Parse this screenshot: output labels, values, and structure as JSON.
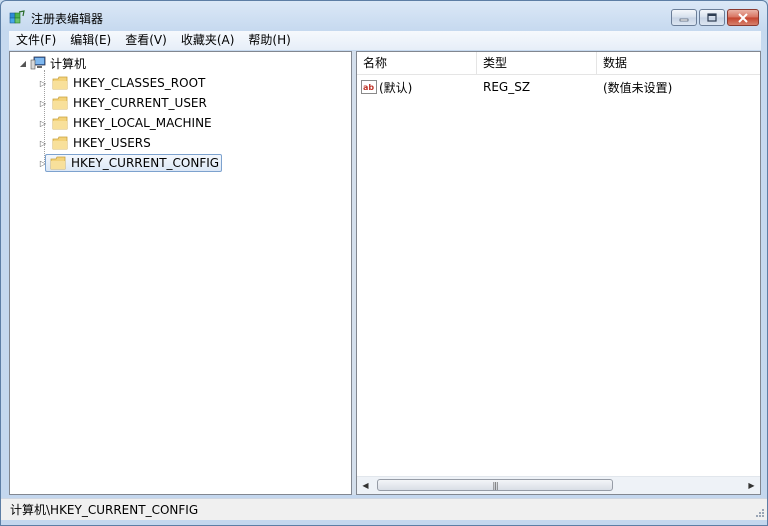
{
  "window": {
    "title": "注册表编辑器"
  },
  "menu": [
    {
      "label": "文件(F)"
    },
    {
      "label": "编辑(E)"
    },
    {
      "label": "查看(V)"
    },
    {
      "label": "收藏夹(A)"
    },
    {
      "label": "帮助(H)"
    }
  ],
  "tree": {
    "root": {
      "label": "计算机",
      "icon": "computer-icon"
    },
    "keys": [
      {
        "label": "HKEY_CLASSES_ROOT",
        "icon": "folder-icon"
      },
      {
        "label": "HKEY_CURRENT_USER",
        "icon": "folder-icon"
      },
      {
        "label": "HKEY_LOCAL_MACHINE",
        "icon": "folder-icon"
      },
      {
        "label": "HKEY_USERS",
        "icon": "folder-icon"
      },
      {
        "label": "HKEY_CURRENT_CONFIG",
        "icon": "folder-icon",
        "selected": true
      }
    ]
  },
  "list": {
    "columns": [
      "名称",
      "类型",
      "数据"
    ],
    "rows": [
      {
        "name": "(默认)",
        "type": "REG_SZ",
        "data": "(数值未设置)",
        "icon": "string-value-icon"
      }
    ]
  },
  "status": {
    "path": "计算机\\HKEY_CURRENT_CONFIG"
  },
  "colors": {
    "selection_border": "#7da2ce",
    "frame": "#c4d7ee"
  }
}
